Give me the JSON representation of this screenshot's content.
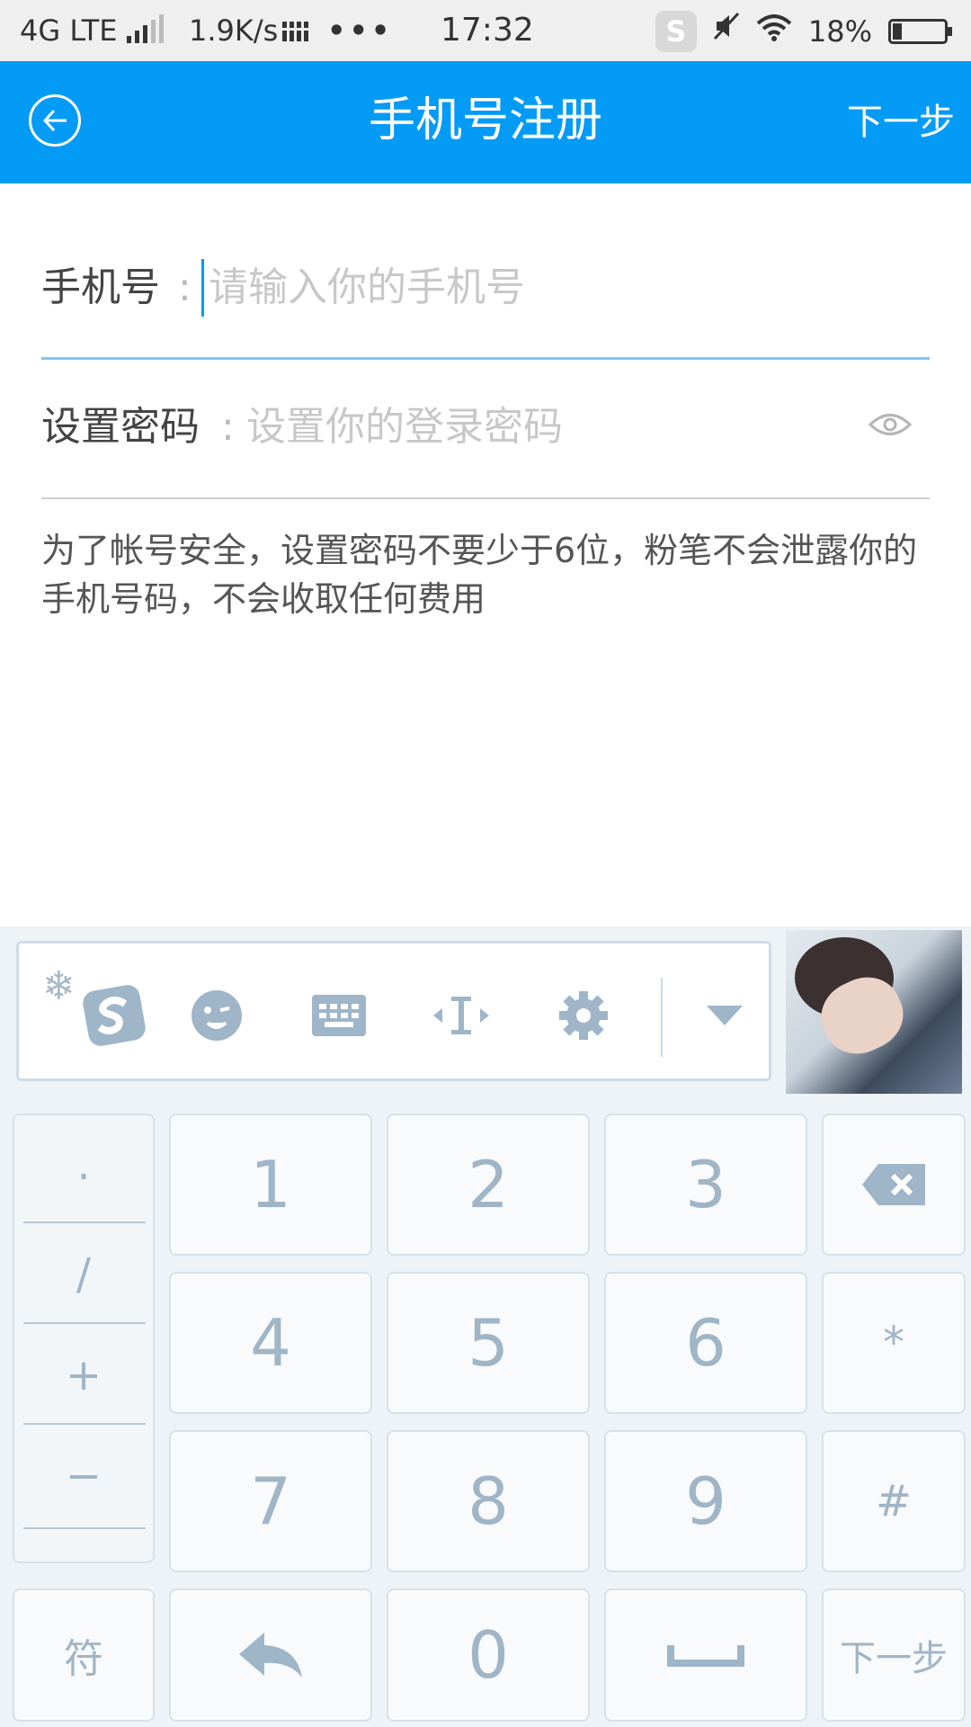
{
  "status_bar": {
    "network": "4G LTE",
    "speed": "1.9K/s",
    "dots": "•••",
    "time": "17:32",
    "battery": "18%",
    "icons": [
      "signal-icon",
      "grid-icon",
      "sogou-icon",
      "mute-icon",
      "wifi-icon",
      "battery-icon"
    ]
  },
  "header": {
    "title": "手机号注册",
    "next": "下一步",
    "back_icon": "back-arrow-icon",
    "color": "#049bf6"
  },
  "form": {
    "phone_label": "手机号",
    "phone_colon": ":",
    "phone_placeholder": "请输入你的手机号",
    "password_label": "设置密码",
    "password_colon": ":",
    "password_placeholder": "设置你的登录密码",
    "eye_icon": "eye-icon",
    "hint": "为了帐号安全，设置密码不要少于6位，粉笔不会泄露你的手机号码，不会收取任何费用"
  },
  "keyboard_toolbar": {
    "icons": [
      "snowflake-icon",
      "sogou-logo-icon",
      "emoji-icon",
      "keyboard-icon",
      "cursor-move-icon",
      "settings-icon",
      "collapse-icon"
    ]
  },
  "keyboard": {
    "left_column": [
      ".",
      "/",
      "+",
      "−"
    ],
    "digits": [
      "1",
      "2",
      "3",
      "4",
      "5",
      "6",
      "7",
      "8",
      "9",
      "0"
    ],
    "star": "*",
    "hash": "#",
    "symbols": "符",
    "next": "下一步",
    "icons": [
      "backspace-icon",
      "return-arrow-icon",
      "space-icon"
    ]
  }
}
